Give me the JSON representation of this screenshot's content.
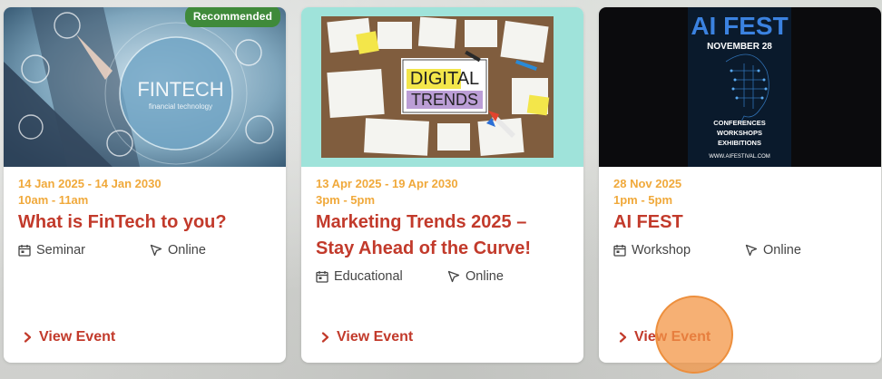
{
  "cards": [
    {
      "badge": "Recommended",
      "image": {
        "name": "fintech-image",
        "caption_main": "FINTECH",
        "caption_sub": "financial technology"
      },
      "dates": "14 Jan 2025 - 14 Jan 2030",
      "time": "10am - 11am",
      "title": "What is FinTech to you?",
      "type": "Seminar",
      "location": "Online",
      "cta": "View Event"
    },
    {
      "image": {
        "name": "digital-trends-image",
        "line1": "DIGITAL",
        "line2": "TRENDS"
      },
      "dates": "13 Apr 2025 - 19 Apr 2030",
      "time": "3pm - 5pm",
      "title": "Marketing Trends 2025 – Stay Ahead of the Curve!",
      "type": "Educational",
      "location": "Online",
      "cta": "View Event"
    },
    {
      "image": {
        "name": "ai-fest-poster",
        "headline": "AI FEST",
        "date": "NOVEMBER 28",
        "l1": "CONFERENCES",
        "l2": "WORKSHOPS",
        "l3": "EXHIBITIONS",
        "url": "WWW.AIFESTIVAL.COM"
      },
      "dates": "28 Nov 2025",
      "time": "1pm - 5pm",
      "title": "AI FEST",
      "type": "Workshop",
      "location": "Online",
      "cta": "View Event"
    }
  ],
  "colors": {
    "accent": "#c23a2b",
    "date": "#f0a93b",
    "badge": "#3f8a3a",
    "cursor": "#f39646"
  }
}
